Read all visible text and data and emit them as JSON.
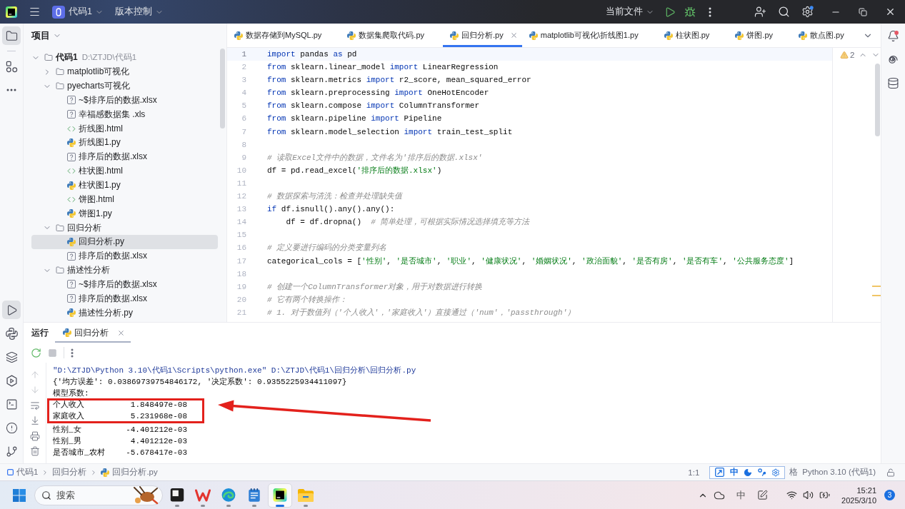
{
  "title_bar": {
    "project": "代码1",
    "vcs": "版本控制",
    "run_config": "当前文件",
    "settings_badge": true
  },
  "left_strip": {
    "top": [
      {
        "kind": "project",
        "selected": true
      },
      {
        "kind": "structure",
        "selected": false
      },
      {
        "kind": "more",
        "selected": false
      }
    ],
    "bottom": [
      {
        "kind": "run",
        "selected": true
      },
      {
        "kind": "python-console",
        "selected": false
      },
      {
        "kind": "layers",
        "selected": false
      },
      {
        "kind": "services",
        "selected": false
      },
      {
        "kind": "terminal",
        "selected": false
      },
      {
        "kind": "problems",
        "selected": false
      },
      {
        "kind": "git",
        "selected": false
      }
    ]
  },
  "project_panel": {
    "title": "项目",
    "tree": [
      {
        "kind": "folder",
        "label": "代码1",
        "path": "D:\\ZTJD\\代码1",
        "expanded": true,
        "selected": false,
        "children": [
          {
            "kind": "folder",
            "label": "matplotlib可视化",
            "expanded": false,
            "selected": false
          },
          {
            "kind": "folder",
            "label": "pyecharts可视化",
            "expanded": true,
            "selected": false,
            "children": [
              {
                "kind": "unknown",
                "label": "~$排序后的数据.xlsx",
                "selected": false
              },
              {
                "kind": "unknown",
                "label": "幸福感数据集 .xls",
                "selected": false
              },
              {
                "kind": "html",
                "label": "折线图.html",
                "selected": false
              },
              {
                "kind": "python",
                "label": "折线图1.py",
                "selected": false
              },
              {
                "kind": "unknown",
                "label": "排序后的数据.xlsx",
                "selected": false
              },
              {
                "kind": "html",
                "label": "柱状图.html",
                "selected": false
              },
              {
                "kind": "python",
                "label": "柱状图1.py",
                "selected": false
              },
              {
                "kind": "html",
                "label": "饼图.html",
                "selected": false
              },
              {
                "kind": "python",
                "label": "饼图1.py",
                "selected": false
              }
            ]
          },
          {
            "kind": "folder",
            "label": "回归分析",
            "expanded": true,
            "selected": false,
            "children": [
              {
                "kind": "python",
                "label": "回归分析.py",
                "selected": true
              },
              {
                "kind": "unknown",
                "label": "排序后的数据.xlsx",
                "selected": false
              }
            ]
          },
          {
            "kind": "folder",
            "label": "描述性分析",
            "expanded": true,
            "selected": false,
            "children": [
              {
                "kind": "unknown",
                "label": "~$排序后的数据.xlsx",
                "selected": false
              },
              {
                "kind": "unknown",
                "label": "排序后的数据.xlsx",
                "selected": false
              },
              {
                "kind": "python",
                "label": "描述性分析.py",
                "selected": false
              }
            ]
          }
        ]
      }
    ]
  },
  "editor": {
    "tabs": [
      {
        "label": "数据存储到MySQL.py",
        "selected": false
      },
      {
        "label": "数据集爬取代码.py",
        "selected": false
      },
      {
        "label": "回归分析.py",
        "selected": true
      },
      {
        "label": "matplotlib可视化\\折线图1.py",
        "selected": false
      },
      {
        "label": "柱状图.py",
        "selected": false
      },
      {
        "label": "饼图.py",
        "selected": false
      },
      {
        "label": "散点图.py",
        "selected": false
      }
    ],
    "inspection": {
      "warnings": "2"
    },
    "lines": [
      {
        "number": "1",
        "current": true,
        "tokens": [
          {
            "kind": "keyword",
            "text": "import"
          },
          {
            "kind": "plain",
            "text": " pandas "
          },
          {
            "kind": "keyword",
            "text": "as"
          },
          {
            "kind": "plain",
            "text": " pd"
          }
        ]
      },
      {
        "number": "2",
        "current": false,
        "tokens": [
          {
            "kind": "keyword",
            "text": "from"
          },
          {
            "kind": "plain",
            "text": " sklearn.linear_model "
          },
          {
            "kind": "keyword",
            "text": "import"
          },
          {
            "kind": "plain",
            "text": " LinearRegression"
          }
        ]
      },
      {
        "number": "3",
        "current": false,
        "tokens": [
          {
            "kind": "keyword",
            "text": "from"
          },
          {
            "kind": "plain",
            "text": " sklearn.metrics "
          },
          {
            "kind": "keyword",
            "text": "import"
          },
          {
            "kind": "plain",
            "text": " r2_score, mean_squared_error"
          }
        ]
      },
      {
        "number": "4",
        "current": false,
        "tokens": [
          {
            "kind": "keyword",
            "text": "from"
          },
          {
            "kind": "plain",
            "text": " sklearn.preprocessing "
          },
          {
            "kind": "keyword",
            "text": "import"
          },
          {
            "kind": "plain",
            "text": " OneHotEncoder"
          }
        ]
      },
      {
        "number": "5",
        "current": false,
        "tokens": [
          {
            "kind": "keyword",
            "text": "from"
          },
          {
            "kind": "plain",
            "text": " sklearn.compose "
          },
          {
            "kind": "keyword",
            "text": "import"
          },
          {
            "kind": "plain",
            "text": " ColumnTransformer"
          }
        ]
      },
      {
        "number": "6",
        "current": false,
        "tokens": [
          {
            "kind": "keyword",
            "text": "from"
          },
          {
            "kind": "plain",
            "text": " sklearn.pipeline "
          },
          {
            "kind": "keyword",
            "text": "import"
          },
          {
            "kind": "plain",
            "text": " Pipeline"
          }
        ]
      },
      {
        "number": "7",
        "current": false,
        "tokens": [
          {
            "kind": "keyword",
            "text": "from"
          },
          {
            "kind": "plain",
            "text": " sklearn.model_selection "
          },
          {
            "kind": "keyword",
            "text": "import"
          },
          {
            "kind": "plain",
            "text": " train_test_split"
          }
        ]
      },
      {
        "number": "8",
        "current": false
      },
      {
        "number": "9",
        "current": false,
        "tokens": [
          {
            "kind": "comment",
            "text": "# 读取Excel文件中的数据，文件名为'排序后的数据.xlsx'"
          }
        ]
      },
      {
        "number": "10",
        "current": false,
        "tokens": [
          {
            "kind": "plain",
            "text": "df = pd.read_excel("
          },
          {
            "kind": "string",
            "text": "'排序后的数据.xlsx'"
          },
          {
            "kind": "plain",
            "text": ")"
          }
        ]
      },
      {
        "number": "11",
        "current": false
      },
      {
        "number": "12",
        "current": false,
        "tokens": [
          {
            "kind": "comment",
            "text": "# 数据探索与清洗：检查并处理缺失值"
          }
        ]
      },
      {
        "number": "13",
        "current": false,
        "tokens": [
          {
            "kind": "keyword",
            "text": "if"
          },
          {
            "kind": "plain",
            "text": " df.isnull().any().any():"
          }
        ]
      },
      {
        "number": "14",
        "current": false,
        "tokens": [
          {
            "kind": "plain",
            "text": "    df = df.dropna()  "
          },
          {
            "kind": "comment",
            "text": "# 简单处理，可根据实际情况选择填充等方法"
          }
        ]
      },
      {
        "number": "15",
        "current": false
      },
      {
        "number": "16",
        "current": false,
        "tokens": [
          {
            "kind": "comment",
            "text": "# 定义要进行编码的分类变量列名"
          }
        ]
      },
      {
        "number": "17",
        "current": false,
        "tokens": [
          {
            "kind": "plain",
            "text": "categorical_cols = ["
          },
          {
            "kind": "string",
            "text": "'性别'"
          },
          {
            "kind": "plain",
            "text": ", "
          },
          {
            "kind": "string",
            "text": "'是否城市'"
          },
          {
            "kind": "plain",
            "text": ", "
          },
          {
            "kind": "string",
            "text": "'职业'"
          },
          {
            "kind": "plain",
            "text": ", "
          },
          {
            "kind": "string",
            "text": "'健康状况'"
          },
          {
            "kind": "plain",
            "text": ", "
          },
          {
            "kind": "string",
            "text": "'婚姻状况'"
          },
          {
            "kind": "plain",
            "text": ", "
          },
          {
            "kind": "string",
            "text": "'政治面貌'"
          },
          {
            "kind": "plain",
            "text": ", "
          },
          {
            "kind": "string",
            "text": "'是否有房'"
          },
          {
            "kind": "plain",
            "text": ", "
          },
          {
            "kind": "string",
            "text": "'是否有车'"
          },
          {
            "kind": "plain",
            "text": ", "
          },
          {
            "kind": "string",
            "text": "'公共服务态度'"
          },
          {
            "kind": "plain",
            "text": "]"
          }
        ]
      },
      {
        "number": "18",
        "current": false
      },
      {
        "number": "19",
        "current": false,
        "tokens": [
          {
            "kind": "comment",
            "text": "# 创建一个ColumnTransformer对象，用于对数据进行转换"
          }
        ]
      },
      {
        "number": "20",
        "current": false,
        "tokens": [
          {
            "kind": "comment",
            "text": "# 它有两个转换操作："
          }
        ]
      },
      {
        "number": "21",
        "current": false,
        "tokens": [
          {
            "kind": "comment",
            "text": "# 1. 对于数值列（'个人收入'，'家庭收入'）直接通过（'num'，'passthrough'）"
          }
        ]
      }
    ]
  },
  "right_strip": [
    {
      "kind": "notifications",
      "badge": true
    },
    {
      "kind": "ai-assistant",
      "badge": false
    },
    {
      "kind": "database",
      "badge": false
    }
  ],
  "run_panel": {
    "title": "运行",
    "tabs": [
      {
        "label": "回归分析",
        "selected": true
      }
    ],
    "toolbar": [
      {
        "kind": "rerun",
        "disabled": false
      },
      {
        "kind": "stop",
        "disabled": true
      },
      {
        "kind": "more",
        "disabled": false
      }
    ],
    "side_toolbar": [
      {
        "kind": "up",
        "disabled": true
      },
      {
        "kind": "down",
        "disabled": true
      },
      {
        "kind": "wrap",
        "disabled": false
      },
      {
        "kind": "scroll-end",
        "disabled": false
      },
      {
        "kind": "print",
        "disabled": false
      },
      {
        "kind": "clear",
        "disabled": false
      }
    ],
    "output": [
      {
        "kind": "command",
        "text": "\"D:\\ZTJD\\Python 3.10\\代码1\\Scripts\\python.exe\" D:\\ZTJD\\代码1\\回归分析\\回归分析.py",
        "highlighted": false
      },
      {
        "kind": "text",
        "text": "{'均方误差': 0.03869739754846172, '决定系数': 0.9355225934411097}",
        "highlighted": false
      },
      {
        "kind": "text",
        "text": "模型系数:",
        "highlighted": false
      },
      {
        "kind": "coefficient",
        "label": "个人收入",
        "value": "1.848497e-08",
        "highlighted": true
      },
      {
        "kind": "coefficient",
        "label": "家庭收入",
        "value": "5.231968e-08",
        "highlighted": true
      },
      {
        "kind": "coefficient",
        "label": "性别_女",
        "value": "-4.401212e-03",
        "highlighted": false
      },
      {
        "kind": "coefficient",
        "label": "性别_男",
        "value": "4.401212e-03",
        "highlighted": false
      },
      {
        "kind": "coefficient",
        "label": "是否城市_农村",
        "value": "-5.678417e-03",
        "highlighted": false
      }
    ]
  },
  "status_bar": {
    "breadcrumbs": [
      {
        "kind": "module",
        "label": "代码1"
      },
      {
        "kind": "folder",
        "label": "回归分析"
      },
      {
        "kind": "python",
        "label": "回归分析.py"
      }
    ],
    "position": "1:1",
    "ime_toolbar": {
      "mode": "中"
    },
    "indent": "格",
    "interpreter": "Python 3.10 (代码1)"
  },
  "taskbar": {
    "search": {
      "placeholder": "搜索"
    },
    "apps": [
      {
        "kind": "square-app",
        "running": true,
        "selected": false
      },
      {
        "kind": "wps",
        "running": true,
        "selected": false
      },
      {
        "kind": "edge",
        "running": true,
        "selected": false
      },
      {
        "kind": "notepad",
        "running": true,
        "selected": false
      },
      {
        "kind": "pycharm",
        "running": true,
        "selected": true
      },
      {
        "kind": "explorer",
        "running": true,
        "selected": false
      }
    ],
    "tray": {
      "ime": "中",
      "time": "15:21",
      "date": "2025/3/10",
      "notifications": "3"
    }
  }
}
